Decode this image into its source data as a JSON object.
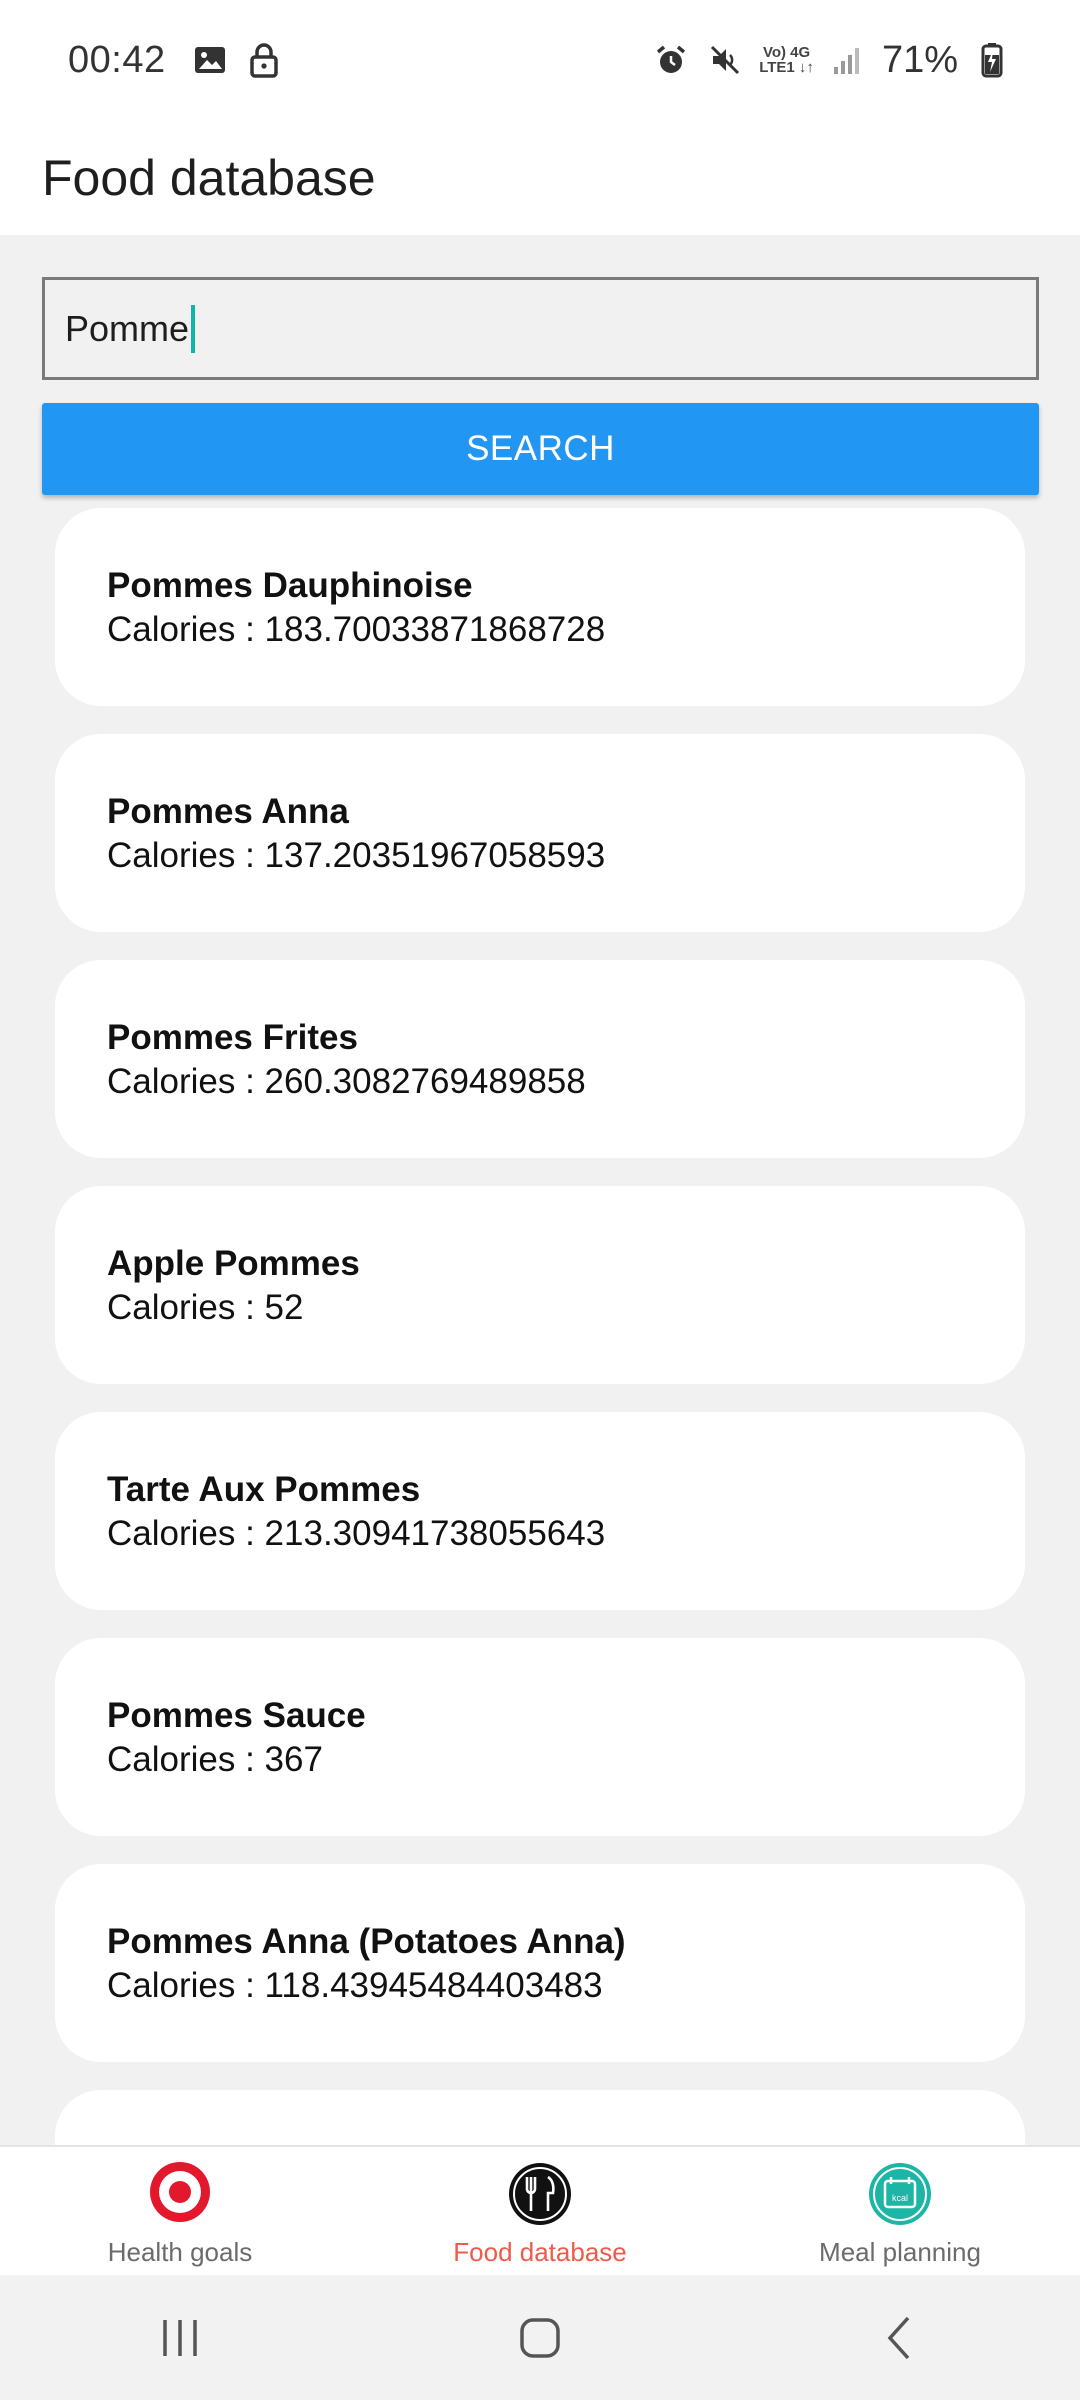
{
  "status_bar": {
    "time": "00:42",
    "net_line1": "Vo) 4G",
    "net_line2": "LTE1 ↓↑",
    "battery": "71%"
  },
  "appbar": {
    "title": "Food database"
  },
  "search": {
    "value": "Pomme",
    "button_label": "SEARCH"
  },
  "results": [
    {
      "name": "Pommes Dauphinoise",
      "calories": "Calories : 183.70033871868728"
    },
    {
      "name": "Pommes Anna",
      "calories": "Calories : 137.20351967058593"
    },
    {
      "name": "Pommes Frites",
      "calories": "Calories : 260.3082769489858"
    },
    {
      "name": "Apple Pommes",
      "calories": "Calories : 52"
    },
    {
      "name": "Tarte Aux Pommes",
      "calories": "Calories : 213.30941738055643"
    },
    {
      "name": "Pommes Sauce",
      "calories": "Calories : 367"
    },
    {
      "name": "Pommes Anna (Potatoes Anna)",
      "calories": "Calories : 118.43945484403483"
    }
  ],
  "bottom_nav": {
    "items": [
      {
        "label": "Health goals",
        "icon": "target-icon"
      },
      {
        "label": "Food database",
        "icon": "fork-knife-icon",
        "active": true
      },
      {
        "label": "Meal planning",
        "icon": "calendar-kcal-icon",
        "icon_text": "kcal"
      }
    ]
  },
  "colors": {
    "accent": "#2196f3",
    "active_nav": "#ef5b4b",
    "caret": "#12b5a5",
    "background": "#f1f1f1"
  }
}
